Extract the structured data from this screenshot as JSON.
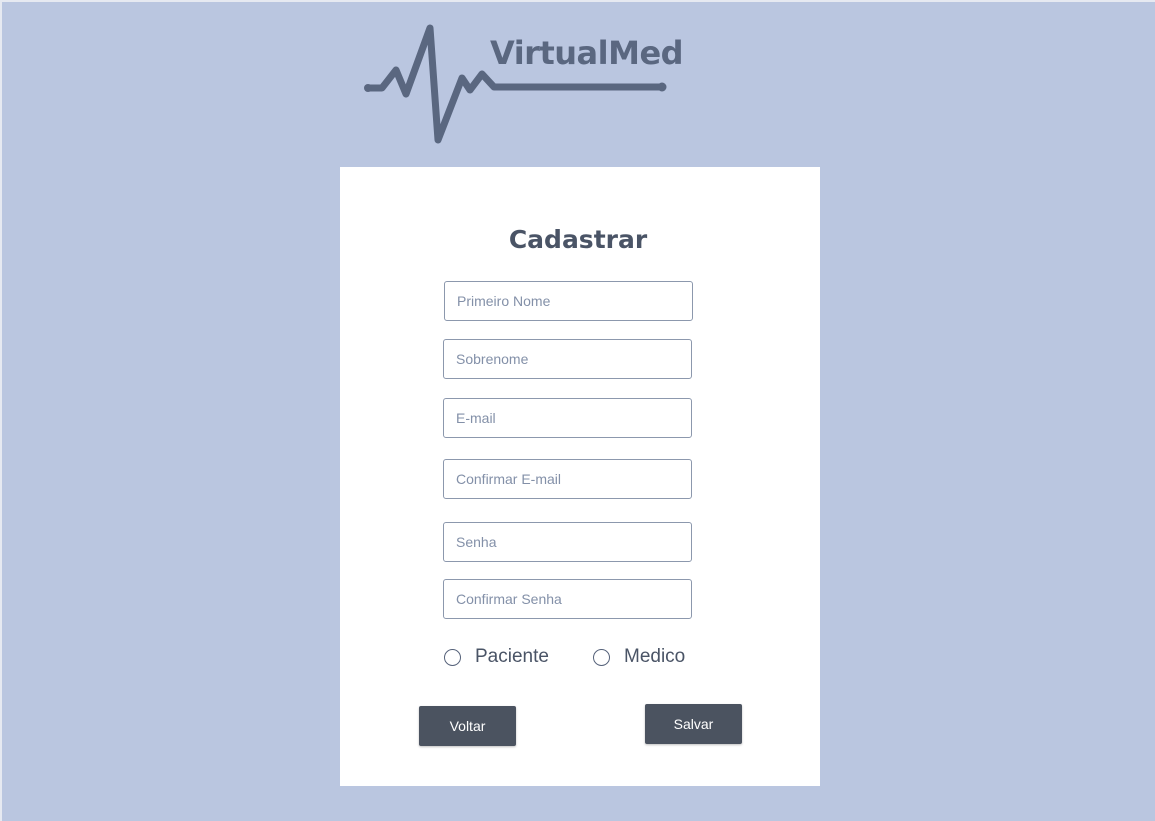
{
  "brand": {
    "name": "VirtualMed"
  },
  "form": {
    "title": "Cadastrar",
    "fields": [
      {
        "placeholder": "Primeiro Nome",
        "value": ""
      },
      {
        "placeholder": "Sobrenome",
        "value": ""
      },
      {
        "placeholder": "E-mail",
        "value": ""
      },
      {
        "placeholder": "Confirmar E-mail",
        "value": ""
      },
      {
        "placeholder": "Senha",
        "value": ""
      },
      {
        "placeholder": "Confirmar Senha",
        "value": ""
      }
    ],
    "user_type": {
      "options": [
        "Paciente",
        "Medico"
      ],
      "selected": ""
    },
    "buttons": {
      "back_label": "Voltar",
      "save_label": "Salvar"
    }
  },
  "colors": {
    "background": "#bac6e0",
    "card": "#ffffff",
    "logo": "#5a6780",
    "button": "#4b5360",
    "text": "#4a5466",
    "placeholder": "#8390a8"
  },
  "icons": [
    "heartbeat-logo-icon",
    "radio-unchecked-icon"
  ]
}
